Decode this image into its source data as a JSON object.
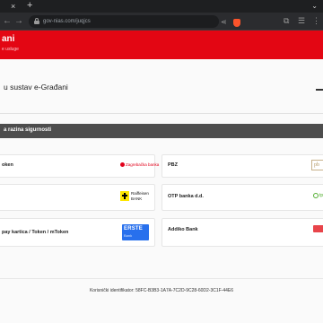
{
  "browser": {
    "tab_close_glyph": "×",
    "new_tab_glyph": "+",
    "tab_menu_glyph": "⌄",
    "url": "gov-nias.com/juqjcs",
    "nav_back_glyph": "←",
    "nav_forward_glyph": "→",
    "share_glyph": "⋖",
    "right_glyphs": [
      "⧉",
      "☰",
      "⋮"
    ]
  },
  "site": {
    "title": "ani",
    "subtitle": "e usluge",
    "header_color": "#e30613"
  },
  "page": {
    "title": "u sustav e-Građani",
    "section_label": "a razina sigurnosti"
  },
  "providers": {
    "left": [
      {
        "label": "oken",
        "logo_text": "Zagrebačka banka",
        "icon": "zaba-logo-icon"
      },
      {
        "label": "",
        "logo_line1": "Raiffeisen",
        "logo_line2": "BANK",
        "icon": "raiffeisen-logo-icon"
      },
      {
        "label": "pay kartica / Token / mToken",
        "logo_line1": "ERSTE",
        "logo_line2": "Bank",
        "icon": "erste-logo-icon"
      }
    ],
    "right": [
      {
        "label": "PBZ",
        "logo_text": "pb",
        "icon": "pbz-logo-icon"
      },
      {
        "label": "OTP banka d.d.",
        "logo_text": "tp",
        "icon": "otp-logo-icon"
      },
      {
        "label": "Addiko Bank",
        "icon": "addiko-logo-icon"
      }
    ]
  },
  "footer": {
    "identifier": "Korisnički identifikator: 58FC-B3B3-1A7A-7C2D-9C28-60D2-3C1F-44E6"
  },
  "colors": {
    "accent": "#e30613",
    "section_bar": "#4d4d4d",
    "background": "#fafafa"
  }
}
